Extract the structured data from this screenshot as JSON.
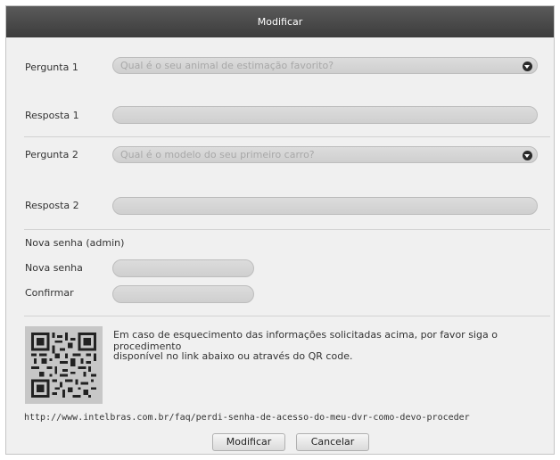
{
  "dialog": {
    "title": "Modificar"
  },
  "question1": {
    "label": "Pergunta 1",
    "value": "Qual é o seu animal de estimação favorito?"
  },
  "answer1": {
    "label": "Resposta 1",
    "value": ""
  },
  "question2": {
    "label": "Pergunta 2",
    "value": "Qual é o modelo do seu primeiro carro?"
  },
  "answer2": {
    "label": "Resposta 2",
    "value": ""
  },
  "password": {
    "section_title": "Nova senha (admin)",
    "new_label": "Nova senha",
    "confirm_label": "Confirmar"
  },
  "help": {
    "line1": "Em caso de esquecimento das informações solicitadas acima, por favor siga o procedimento",
    "line2": "disponível no link abaixo ou através do QR code.",
    "link": "http://www.intelbras.com.br/faq/perdi-senha-de-acesso-do-meu-dvr-como-devo-proceder"
  },
  "buttons": {
    "modify": "Modificar",
    "cancel": "Cancelar"
  },
  "icons": {
    "dropdown": "chevron-down-icon",
    "qr": "qr-code-icon"
  }
}
